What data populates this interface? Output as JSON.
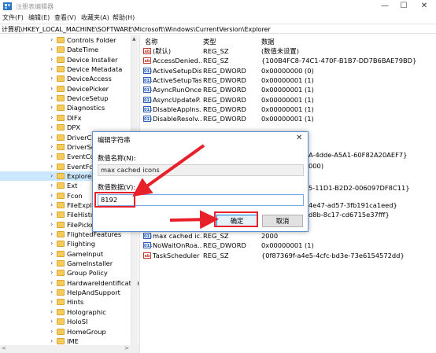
{
  "window": {
    "title": "注册表编辑器",
    "minimize": "—",
    "maximize": "☐",
    "close": "✕"
  },
  "menu": [
    "文件(F)",
    "编辑(E)",
    "查看(V)",
    "收藏夹(A)",
    "帮助(H)"
  ],
  "address": "计算机\\HKEY_LOCAL_MACHINE\\SOFTWARE\\Microsoft\\Windows\\CurrentVersion\\Explorer",
  "tree": {
    "items": [
      "Controls Folder",
      "DateTime",
      "Device Installer",
      "Device Metadata",
      "DeviceAccess",
      "DevicePicker",
      "DeviceSetup",
      "Diagnostics",
      "DIFx",
      "DPX",
      "DriverCo",
      "DriverSea",
      "EventColl",
      "EventForw",
      "Explorer",
      "Ext",
      "Fcon",
      "FileExplo",
      "FileHistor",
      "FilePicker",
      "FlightedFeatures",
      "Flighting",
      "GameInput",
      "GameInstaller",
      "Group Policy",
      "HardwareIdentification",
      "HelpAndSupport",
      "Hints",
      "Holographic",
      "HoloSI",
      "HomeGroup",
      "IME"
    ],
    "selected_index": 14
  },
  "values": {
    "headers": {
      "name": "名称",
      "type": "类型",
      "data": "数据"
    },
    "rows_top": [
      {
        "icon": "ab",
        "name": "(默认)",
        "type": "REG_SZ",
        "data": "(数值未设置)"
      },
      {
        "icon": "ab",
        "name": "AccessDenied...",
        "type": "REG_SZ",
        "data": "{100B4FC8-74C1-470F-B1B7-DD7B6BAE79BD}"
      },
      {
        "icon": "dw",
        "name": "ActiveSetupDis...",
        "type": "REG_DWORD",
        "data": "0x00000000 (0)"
      },
      {
        "icon": "dw",
        "name": "ActiveSetupTas...",
        "type": "REG_DWORD",
        "data": "0x00000001 (1)"
      },
      {
        "icon": "dw",
        "name": "AsyncRunOnce",
        "type": "REG_DWORD",
        "data": "0x00000001 (1)"
      },
      {
        "icon": "dw",
        "name": "AsyncUpdateP...",
        "type": "REG_DWORD",
        "data": "0x00000001 (1)"
      },
      {
        "icon": "dw",
        "name": "DisableAppIns...",
        "type": "REG_DWORD",
        "data": "0x00000001 (1)"
      },
      {
        "icon": "dw",
        "name": "DisableResolv...",
        "type": "REG_DWORD",
        "data": "0x00000001 (1)"
      }
    ],
    "partial_data": [
      "A-4dde-A5A1-60F82A20AEF7}",
      "000)",
      "5-11D1-B2D2-006097DF8C11}",
      "4e47-ad57-3fb191ca1eed}",
      "d8b-8c17-cd6715e37fff}"
    ],
    "rows_bottom": [
      {
        "icon": "dw",
        "name": "max cached ic...",
        "type": "REG_SZ",
        "data": "2000"
      },
      {
        "icon": "dw",
        "name": "NoWaitOnRoa...",
        "type": "REG_DWORD",
        "data": "0x00000001 (1)"
      },
      {
        "icon": "ab",
        "name": "TaskScheduler",
        "type": "REG_SZ",
        "data": "{0f87369f-a4e5-4cfc-bd3e-73e6154572dd}"
      }
    ]
  },
  "dialog": {
    "title": "编辑字符串",
    "close": "✕",
    "name_label": "数值名称(N):",
    "name_value": "max cached icons",
    "data_label": "数值数据(V):",
    "data_value": "8192",
    "ok_label": "确定",
    "cancel_label": "取消"
  },
  "colors": {
    "annotation": "#e8202a",
    "selection": "#cce8ff",
    "folder": "#f5cc5c"
  }
}
